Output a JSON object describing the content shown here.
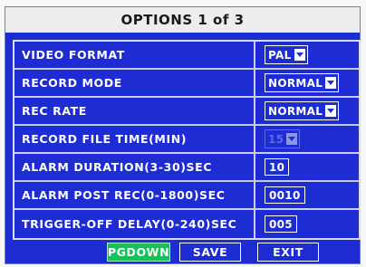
{
  "dialog": {
    "title": "OPTIONS 1 of 3"
  },
  "settings": [
    {
      "label": "VIDEO FORMAT",
      "type": "select",
      "value": "PAL"
    },
    {
      "label": "RECORD MODE",
      "type": "select",
      "value": "NORMAL"
    },
    {
      "label": "REC RATE",
      "type": "select",
      "value": "NORMAL"
    },
    {
      "label": "RECORD FILE TIME(MIN)",
      "type": "select",
      "value": "15",
      "disabled": true
    },
    {
      "label": "ALARM DURATION(3-30)SEC",
      "type": "number",
      "value": "10"
    },
    {
      "label": "ALARM POST REC(0-1800)SEC",
      "type": "number",
      "value": "0010"
    },
    {
      "label": "TRIGGER-OFF DELAY(0-240)SEC",
      "type": "number",
      "value": "005"
    }
  ],
  "buttons": {
    "pgdown": "PGDOWN",
    "save": "SAVE",
    "exit": "EXIT"
  },
  "colors": {
    "panel": "#1d2cd3",
    "active_button": "#12c35a",
    "title_bg": "#ededed"
  },
  "icons": {
    "dropdown": "chevron-down-icon"
  }
}
